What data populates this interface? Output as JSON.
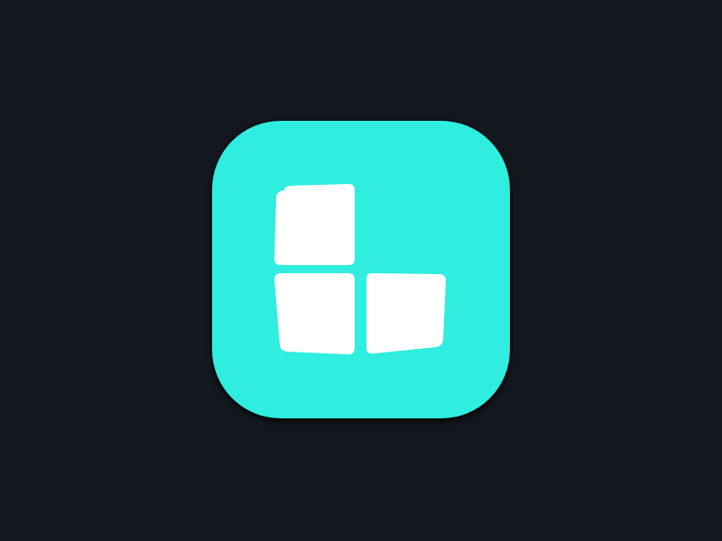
{
  "canvas": {
    "background_color": "#13171e"
  },
  "app_icon": {
    "icon_name": "three-blocks-l-shape-icon",
    "tile_color": "#2feddf",
    "glyph_color": "#ffffff",
    "block_count": 3
  }
}
